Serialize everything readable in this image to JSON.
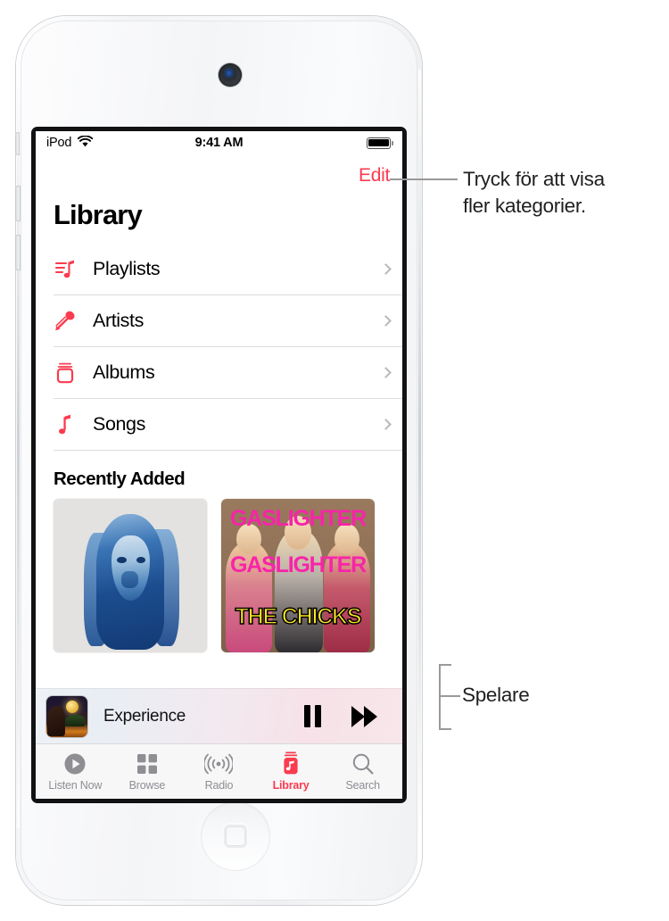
{
  "device": {
    "name": "iPod touch",
    "camera_icon": "front-camera",
    "home_button_icon": "home-button"
  },
  "screen": {
    "status_bar": {
      "carrier": "iPod",
      "wifi_icon": "wifi-icon",
      "time": "9:41 AM",
      "battery_icon": "battery-full-icon"
    },
    "nav": {
      "edit_label": "Edit"
    },
    "page_title": "Library",
    "library_rows": [
      {
        "label": "Playlists",
        "icon": "playlist-note-icon",
        "chevron": "chevron-right-icon"
      },
      {
        "label": "Artists",
        "icon": "microphone-icon",
        "chevron": "chevron-right-icon"
      },
      {
        "label": "Albums",
        "icon": "albums-stack-icon",
        "chevron": "chevron-right-icon"
      },
      {
        "label": "Songs",
        "icon": "music-note-icon",
        "chevron": "chevron-right-icon"
      }
    ],
    "recently_added": {
      "title": "Recently Added",
      "albums": [
        {
          "name": "blue-portrait-album-art",
          "title": ""
        },
        {
          "name": "gaslighter-album-art",
          "line1": "GASLIGHTER",
          "line2": "GASLIGHTER",
          "line3": "THE CHICKS"
        }
      ]
    },
    "mini_player": {
      "artwork": "now-playing-artwork",
      "track_title": "Experience",
      "pause_icon": "pause-icon",
      "forward_icon": "fast-forward-icon"
    },
    "tab_bar": [
      {
        "label": "Listen Now",
        "icon": "play-circle-icon",
        "active": false
      },
      {
        "label": "Browse",
        "icon": "grid-squares-icon",
        "active": false
      },
      {
        "label": "Radio",
        "icon": "radio-waves-icon",
        "active": false
      },
      {
        "label": "Library",
        "icon": "library-music-icon",
        "active": true
      },
      {
        "label": "Search",
        "icon": "search-icon",
        "active": false
      }
    ]
  },
  "callouts": [
    {
      "id": "edit-callout",
      "line1": "Tryck för att visa",
      "line2": "fler kategorier."
    },
    {
      "id": "player-callout",
      "line1": "Spelare"
    }
  ],
  "colors": {
    "accent_red": "#fb3b4e",
    "inactive_gray": "#8e8e93",
    "leader_gray": "#9a9a9a",
    "separator": "#dcdcdd"
  }
}
